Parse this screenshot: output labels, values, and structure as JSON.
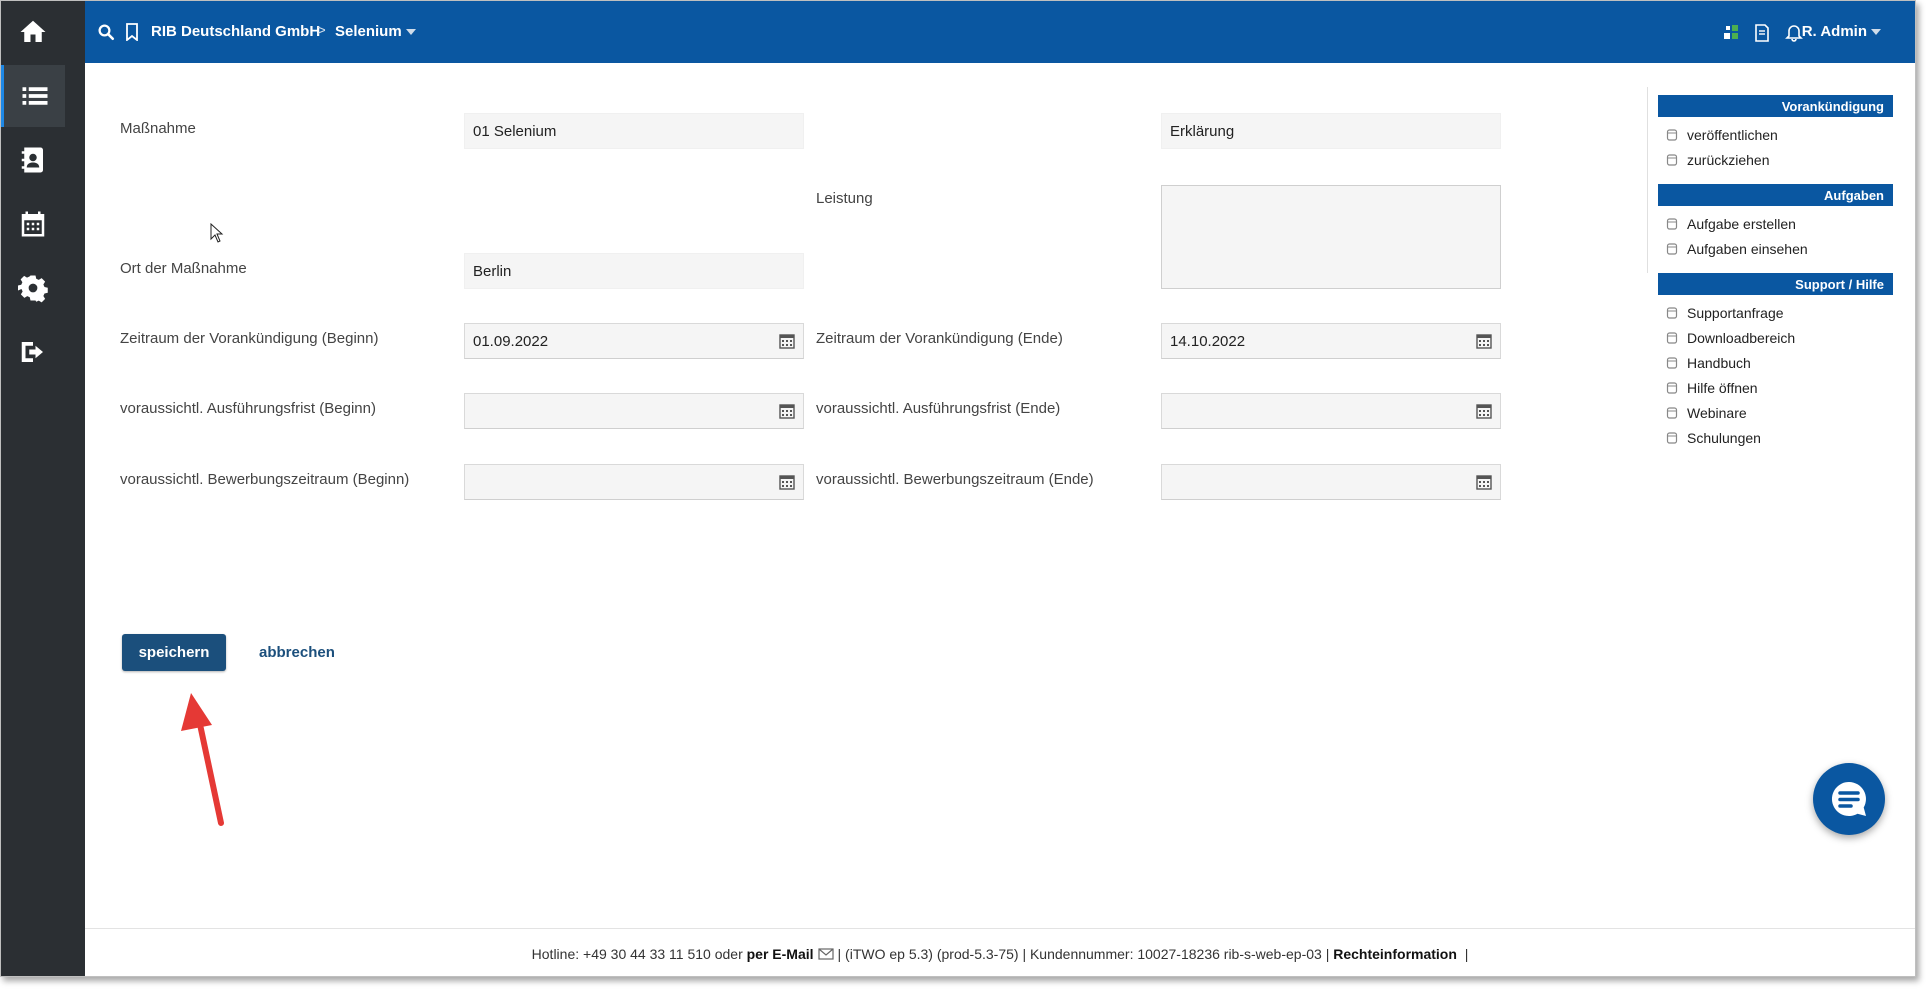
{
  "topbar": {
    "company": "RIB Deutschland GmbH",
    "separator": ">",
    "project": "Selenium",
    "user": "R. Admin"
  },
  "rail": {
    "items": [
      "home-icon",
      "list-icon",
      "contacts-icon",
      "calendar-icon",
      "settings-icon",
      "logout-icon"
    ]
  },
  "form": {
    "massnahme_label": "Maßnahme",
    "massnahme_value": "01 Selenium",
    "erklaerung_value": "Erklärung",
    "leistung_label": "Leistung",
    "ort_label": "Ort der Maßnahme",
    "ort_value": "Berlin",
    "vorank_begin_label": "Zeitraum der Vorankündigung (Beginn)",
    "vorank_begin_value": "01.09.2022",
    "vorank_end_label": "Zeitraum der Vorankündigung (Ende)",
    "vorank_end_value": "14.10.2022",
    "ausf_begin_label": "voraussichtl. Ausführungsfrist (Beginn)",
    "ausf_end_label": "voraussichtl. Ausführungsfrist (Ende)",
    "bew_begin_label": "voraussichtl. Bewerbungszeitraum (Beginn)",
    "bew_end_label": "voraussichtl. Bewerbungszeitraum (Ende)",
    "save_label": "speichern",
    "cancel_label": "abbrechen"
  },
  "panel": {
    "sections": [
      {
        "title": "Vorankündigung",
        "items": [
          "veröffentlichen",
          "zurückziehen"
        ]
      },
      {
        "title": "Aufgaben",
        "items": [
          "Aufgabe erstellen",
          "Aufgaben einsehen"
        ]
      },
      {
        "title": "Support / Hilfe",
        "items": [
          "Supportanfrage",
          "Downloadbereich",
          "Handbuch",
          "Hilfe öffnen",
          "Webinare",
          "Schulungen"
        ]
      }
    ]
  },
  "footer": {
    "hotline": "Hotline: +49 30 44 33 11 510 oder",
    "email_label": "per E-Mail",
    "version": "|  (iTWO ep 5.3) (prod-5.3-75)  |  Kundennummer: 10027-18236 rib-s-web-ep-03 |",
    "legal": "Rechteinformation",
    "end": "|"
  },
  "colors": {
    "brand": "#0a57a1",
    "rail": "#2b2f33",
    "button": "#1b4f7c",
    "annotation": "#e53935"
  }
}
